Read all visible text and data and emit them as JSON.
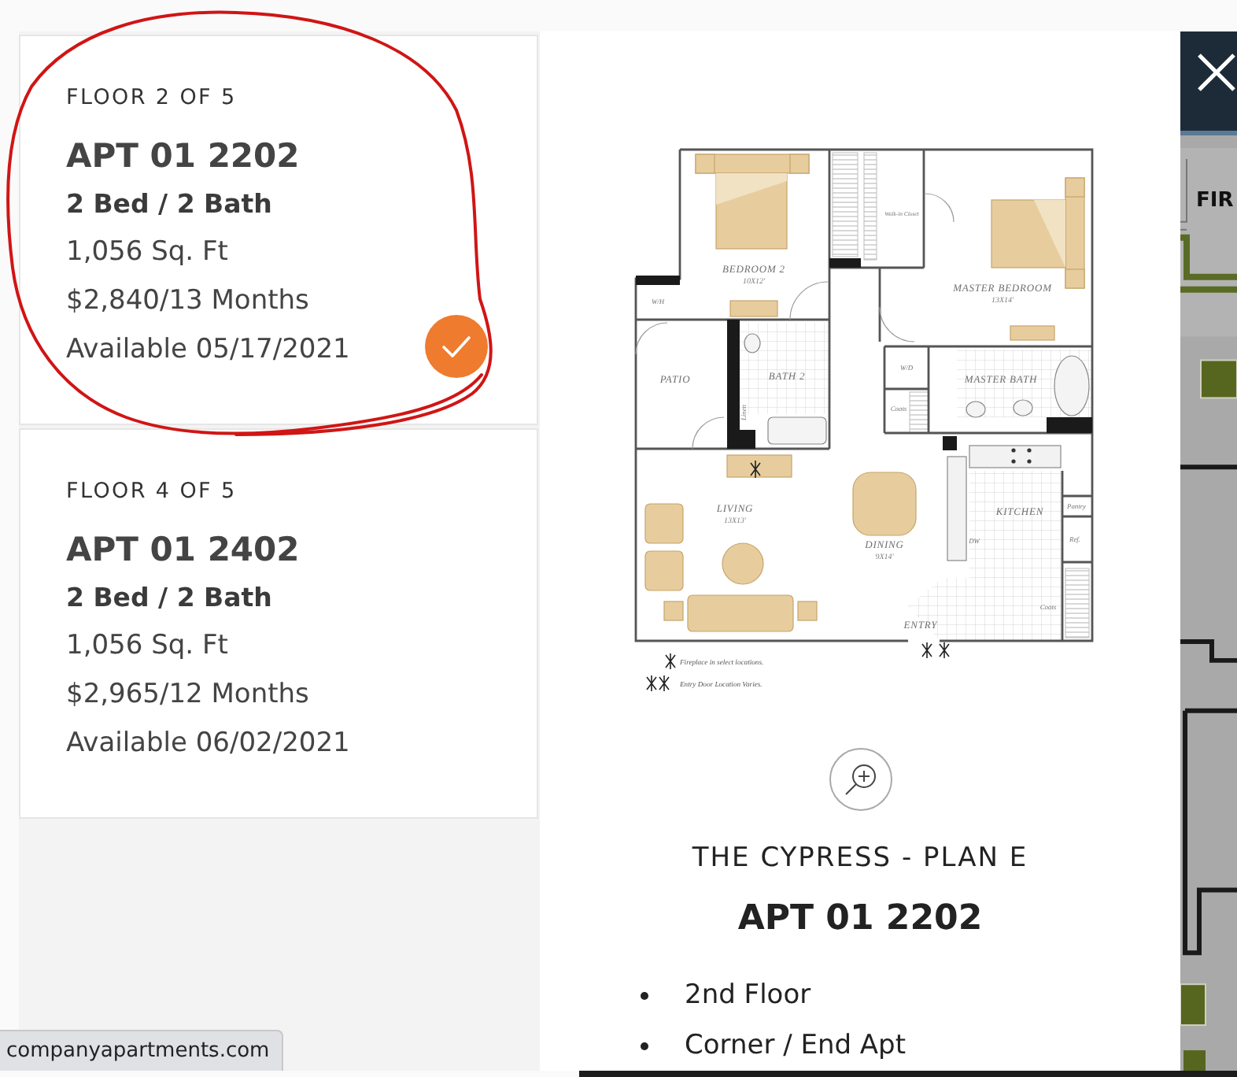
{
  "units": [
    {
      "floor": "FLOOR 2 OF 5",
      "name": "APT 01 2202",
      "layout": "2 Bed / 2 Bath",
      "area": "1,056 Sq. Ft",
      "price": "$2,840/13 Months",
      "available": "Available 05/17/2021",
      "selected": true
    },
    {
      "floor": "FLOOR 4 OF 5",
      "name": "APT 01 2402",
      "layout": "2 Bed / 2 Bath",
      "area": "1,056 Sq. Ft",
      "price": "$2,965/12 Months",
      "available": "Available 06/02/2021",
      "selected": false
    }
  ],
  "floor_plan": {
    "rooms": [
      {
        "label": "BEDROOM 2",
        "size": "10X12'"
      },
      {
        "label": "MASTER BEDROOM",
        "size": "13X14'"
      },
      {
        "label": "PATIO"
      },
      {
        "label": "BATH 2"
      },
      {
        "label": "MASTER BATH"
      },
      {
        "label": "LIVING",
        "size": "13X13'"
      },
      {
        "label": "DINING",
        "size": "9X14'"
      },
      {
        "label": "KITCHEN"
      },
      {
        "label": "ENTRY"
      }
    ],
    "fixtures": [
      "Walk-in Closet",
      "W/H",
      "W/D",
      "Coats",
      "Linen",
      "Pantry",
      "Ref.",
      "DW",
      "Coats"
    ],
    "legend": [
      "Fireplace in select locations.",
      "Entry Door Location Varies."
    ]
  },
  "plan": {
    "title": "THE CYPRESS - PLAN E",
    "name": "APT 01 2202",
    "features": [
      "2nd Floor",
      "Corner / End Apt"
    ]
  },
  "map": {
    "label": "FIR"
  },
  "status_bar": {
    "url": "companyapartments.com"
  }
}
